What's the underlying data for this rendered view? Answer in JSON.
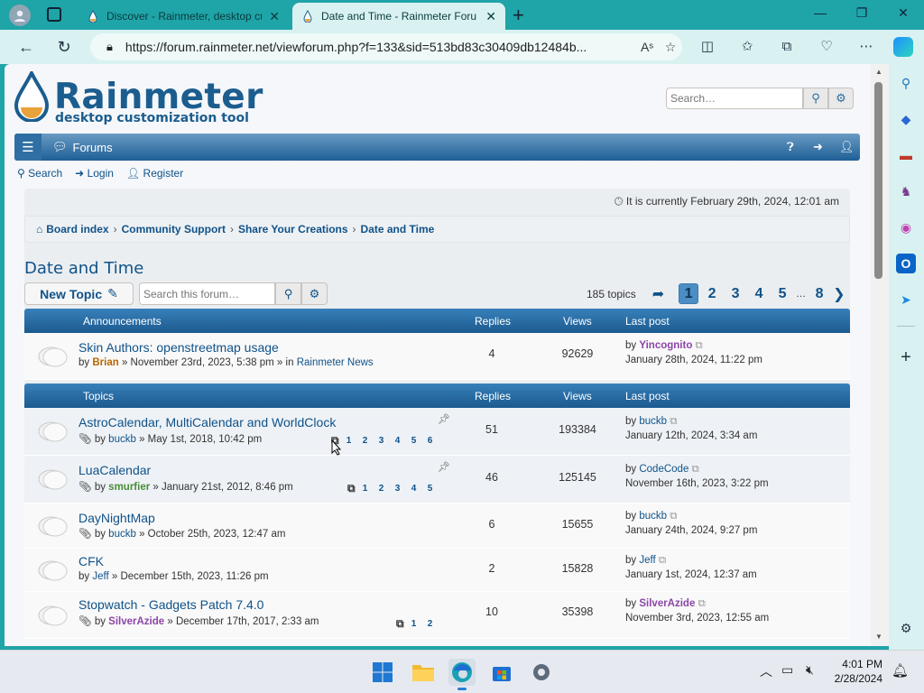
{
  "browser": {
    "tabs": [
      {
        "title": "Discover - Rainmeter, desktop cu"
      },
      {
        "title": "Date and Time - Rainmeter Foru"
      }
    ],
    "url": "https://forum.rainmeter.net/viewforum.php?f=133&sid=513bd83c30409db12484b..."
  },
  "header": {
    "logo_main": "Rainmeter",
    "logo_sub": "desktop customization tool",
    "search_placeholder": "Search…"
  },
  "navbar": {
    "forums_label": "Forums"
  },
  "links": {
    "search": "Search",
    "login": "Login",
    "register": "Register"
  },
  "current_time": "It is currently February 29th, 2024, 12:01 am",
  "breadcrumb": [
    "Board index",
    "Community Support",
    "Share Your Creations",
    "Date and Time"
  ],
  "forum": {
    "title": "Date and Time",
    "new_topic": "New Topic",
    "search_placeholder": "Search this forum…",
    "topics_count": "185 topics",
    "pages": [
      "1",
      "2",
      "3",
      "4",
      "5",
      "…",
      "8"
    ]
  },
  "announcements": {
    "header": {
      "col1": "Announcements",
      "replies": "Replies",
      "views": "Views",
      "last": "Last post"
    },
    "rows": [
      {
        "title": "Skin Authors: openstreetmap usage",
        "by": "by",
        "author": "Brian",
        "date": "» November 23rd, 2023, 5:38 pm » in",
        "forum": "Rainmeter News",
        "replies": "4",
        "views": "92629",
        "lp_by": "by",
        "lp_user": "Yincognito",
        "lp_date": "January 28th, 2024, 11:22 pm"
      }
    ]
  },
  "topics": {
    "header": {
      "col1": "Topics",
      "replies": "Replies",
      "views": "Views",
      "last": "Last post"
    },
    "rows": [
      {
        "title": "AstroCalendar, MultiCalendar and WorldClock",
        "by": "by",
        "author": "buckb",
        "date": "» May 1st, 2018, 10:42 pm",
        "replies": "51",
        "views": "193384",
        "lp_by": "by",
        "lp_user": "buckb",
        "lp_date": "January 12th, 2024, 3:34 am",
        "pages": [
          "1",
          "2",
          "3",
          "4",
          "5",
          "6"
        ]
      },
      {
        "title": "LuaCalendar",
        "by": "by",
        "author": "smurfier",
        "date": "» January 21st, 2012, 8:46 pm",
        "replies": "46",
        "views": "125145",
        "lp_by": "by",
        "lp_user": "CodeCode",
        "lp_date": "November 16th, 2023, 3:22 pm",
        "pages": [
          "1",
          "2",
          "3",
          "4",
          "5"
        ]
      },
      {
        "title": "DayNightMap",
        "by": "by",
        "author": "buckb",
        "date": "» October 25th, 2023, 12:47 am",
        "replies": "6",
        "views": "15655",
        "lp_by": "by",
        "lp_user": "buckb",
        "lp_date": "January 24th, 2024, 9:27 pm"
      },
      {
        "title": "CFK",
        "by": "by",
        "author": "Jeff",
        "date": "» December 15th, 2023, 11:26 pm",
        "replies": "2",
        "views": "15828",
        "lp_by": "by",
        "lp_user": "Jeff",
        "lp_date": "January 1st, 2024, 12:37 am"
      },
      {
        "title": "Stopwatch - Gadgets Patch 7.4.0",
        "by": "by",
        "author": "SilverAzide",
        "date": "» December 17th, 2017, 2:33 am",
        "replies": "10",
        "views": "35398",
        "lp_by": "by",
        "lp_user": "SilverAzide",
        "lp_date": "November 3rd, 2023, 12:55 am",
        "pages": [
          "1",
          "2"
        ]
      }
    ]
  },
  "taskbar": {
    "time": "4:01 PM",
    "date": "2/28/2024"
  }
}
